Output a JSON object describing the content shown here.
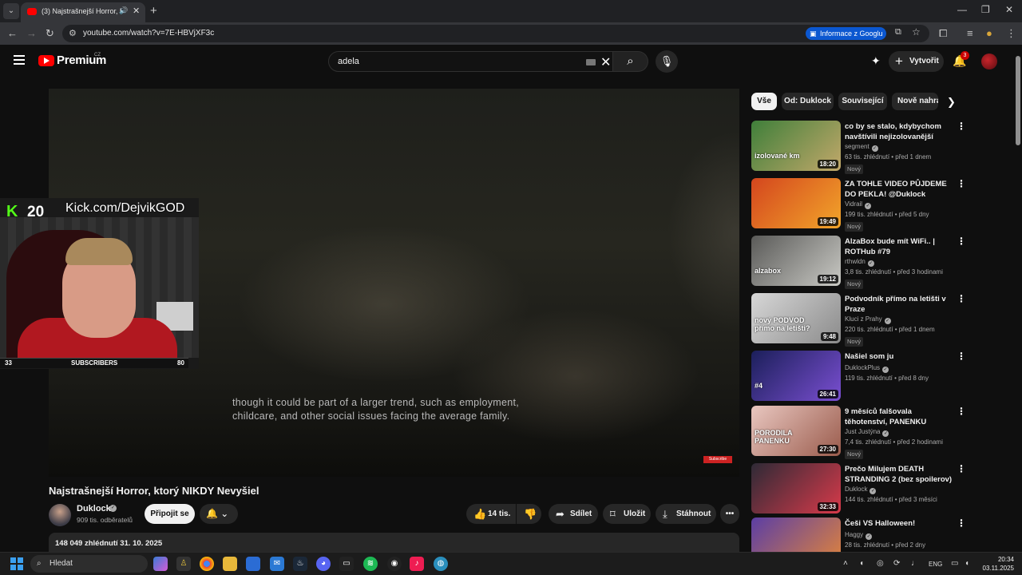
{
  "browser": {
    "tab_title": "(3) Najstrašnejší Horror, ktorý",
    "new_tab": "+",
    "address": "youtube.com/watch?v=7E-HBVjXF3c",
    "google_info": "Informace z Googlu"
  },
  "header": {
    "logo_text": "Premium",
    "country": "CZ",
    "search_query": "adela",
    "create_label": "Vytvořit",
    "notification_count": "3"
  },
  "player": {
    "caption_line1": "though it could be part of a larger trend, such as employment,",
    "caption_line2": "childcare, and other social issues facing the average family.",
    "subscribe_mini": "Subscribe",
    "overlay": {
      "kick_count": "20",
      "kick_url": "Kick.com/DejvikGOD",
      "bar_left": "33",
      "bar_label": "SUBSCRIBERS",
      "bar_right": "80"
    }
  },
  "video": {
    "title": "Najstrašnejší Horror, ktorý NIKDY Nevyšiel",
    "channel": "Duklock",
    "subscribers": "909 tis. odběratelů",
    "join": "Připojit se",
    "likes": "14 tis.",
    "share": "Sdílet",
    "save": "Uložit",
    "download": "Stáhnout",
    "more": "•••",
    "stats": "148 049 zhlédnutí  31. 10. 2025"
  },
  "chips": [
    "Vše",
    "Od: Duklock",
    "Související",
    "Nově nahráno"
  ],
  "recommendations": [
    {
      "title": "co by se stalo, kdybychom navštívili nejizolovanější kmen...",
      "channel": "segment",
      "meta": "63 tis. zhlédnutí • před 1 dnem",
      "badge": "Nový",
      "duration": "18:20",
      "thumb_label": "izolované km",
      "colors": [
        "#3f7f3a",
        "#c2a86a"
      ]
    },
    {
      "title": "ZA TOHLE VIDEO PŮJDEME DO PEKLA! @Duklock",
      "channel": "Vidrail",
      "meta": "199 tis. zhlédnutí • před 5 dny",
      "badge": "Nový",
      "duration": "19:49",
      "thumb_label": "",
      "colors": [
        "#d4461e",
        "#f2a52a"
      ]
    },
    {
      "title": "AlzaBox bude mít WiFi.. | ROTHub #79",
      "channel": "rthwldn",
      "meta": "3,8 tis. zhlédnutí • před 3 hodinami",
      "badge": "Nový",
      "duration": "19:12",
      "thumb_label": "alzabox",
      "colors": [
        "#5a5a58",
        "#c9c9c4"
      ]
    },
    {
      "title": "Podvodník přímo na letišti v Praze",
      "channel": "Kluci z Prahy",
      "meta": "220 tis. zhlédnutí • před 1 dnem",
      "badge": "Nový",
      "duration": "9:48",
      "thumb_label": "nový PODVOD přímo na letišti?",
      "colors": [
        "#d7d7d7",
        "#8b8b8b"
      ]
    },
    {
      "title": "Našiel som ju",
      "channel": "DuklockPlus",
      "meta": "119 tis. zhlédnutí • před 8 dny",
      "badge": "",
      "duration": "26:41",
      "thumb_label": "#4",
      "colors": [
        "#1b1f5a",
        "#7a4fd1"
      ]
    },
    {
      "title": "9 měsíců falšovala těhotenství, PANENKU VYDÁVALA ZA DÍTĚ...",
      "channel": "Just Justýna",
      "meta": "7,4 tis. zhlédnutí • před 2 hodinami",
      "badge": "Nový",
      "duration": "27:30",
      "thumb_label": "PORODILA PANENKU",
      "colors": [
        "#e9c7c0",
        "#9a5b4c"
      ]
    },
    {
      "title": "Prečo Milujem DEATH STRANDING 2 (bez spoilerov)",
      "channel": "Duklock",
      "meta": "144 tis. zhlédnutí • před 3 měsíci",
      "badge": "",
      "duration": "32:33",
      "thumb_label": "",
      "colors": [
        "#2e2a36",
        "#d83a4a"
      ]
    },
    {
      "title": "Češi VS Halloween!",
      "channel": "Haggy",
      "meta": "28 tis. zhlédnutí • před 2 dny",
      "badge": "",
      "duration": "",
      "thumb_label": "",
      "colors": [
        "#5b3ea5",
        "#e2853a"
      ]
    }
  ],
  "taskbar": {
    "search": "Hledat",
    "lang": "ENG",
    "time": "20:34",
    "date": "03.11.2025"
  }
}
